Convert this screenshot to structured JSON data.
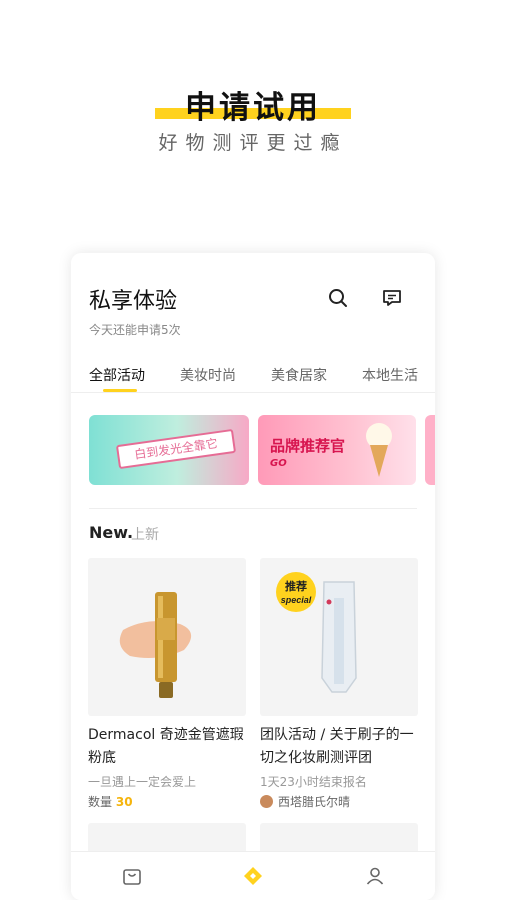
{
  "hero": {
    "title": "申请试用",
    "subtitle": "好物测评更过瘾"
  },
  "card": {
    "title": "私享体验",
    "subtitle": "今天还能申请5次",
    "icons": [
      "search-icon",
      "message-icon"
    ],
    "tabs": [
      {
        "label": "全部活动",
        "active": true
      },
      {
        "label": "美妆时尚",
        "active": false
      },
      {
        "label": "美食居家",
        "active": false
      },
      {
        "label": "本地生活",
        "active": false
      }
    ],
    "banners": [
      {
        "text": "白到发光全靠它"
      },
      {
        "text": "品牌推荐官",
        "tag": "GO"
      }
    ],
    "new_section": {
      "label": "New.",
      "cn": "上新"
    },
    "products": [
      {
        "name": "Dermacol 奇迹金管遮瑕粉底",
        "meta": "一旦遇上一定会爱上",
        "qty_label": "数量",
        "qty": "30"
      },
      {
        "name": "团队活动 / 关于刷子的一切之化妆刷测评团",
        "meta": "1天23小时结束报名",
        "author": "西塔腊氏尔晴",
        "badge": "推荐 special"
      }
    ]
  },
  "bottom_nav": [
    "bag-icon",
    "home-diamond-icon",
    "user-icon"
  ],
  "colors": {
    "accent": "#FFD21E",
    "qty": "#F5B40C"
  }
}
